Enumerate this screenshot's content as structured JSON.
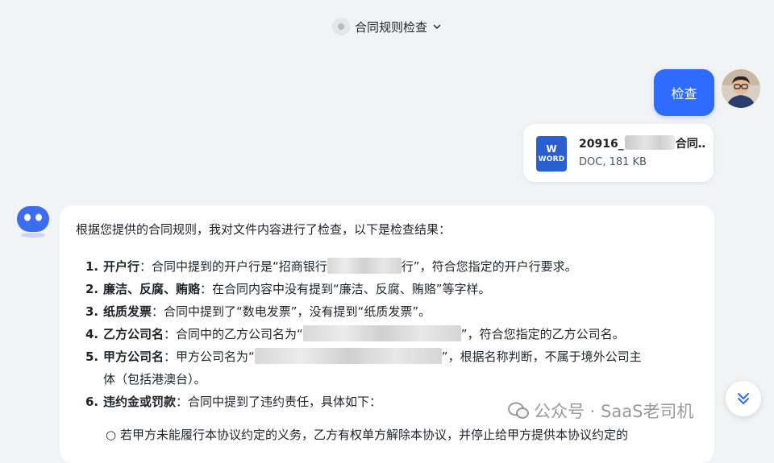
{
  "header": {
    "title": "合同规则检查"
  },
  "user": {
    "message": "检查",
    "file": {
      "name_prefix": "20916_",
      "name_suffix": "合同…",
      "meta": "DOC, 181 KB",
      "icon_letter": "W",
      "icon_label": "WORD"
    }
  },
  "bot": {
    "intro": "根据您提供的合同规则，我对文件内容进行了检查，以下是检查结果：",
    "items": [
      {
        "num": "1.",
        "title": "开户行",
        "text_a": "：合同中提到的开户行是“招商银行",
        "text_b": "行”，符合您指定的开户行要求。"
      },
      {
        "num": "2.",
        "title": "廉洁、反腐、贿赂",
        "text_a": "：在合同内容中没有提到“廉洁、反腐、贿赂”等字样。"
      },
      {
        "num": "3.",
        "title": "纸质发票",
        "text_a": "：合同中提到了“数电发票”，没有提到“纸质发票”。"
      },
      {
        "num": "4.",
        "title": "乙方公司名",
        "text_a": "：合同中的乙方公司名为“",
        "text_b": "”，符合您指定的乙方公司名。"
      },
      {
        "num": "5.",
        "title": "甲方公司名",
        "text_a": "：甲方公司名为“",
        "text_b": "”，根据名称判断，不属于境外公司主",
        "text_c": "体（包括港澳台）。"
      },
      {
        "num": "6.",
        "title": "违约金或罚款",
        "text_a": "：合同中提到了违约责任，具体如下："
      }
    ],
    "sub_item": "若甲方未能履行本协议约定的义务，乙方有权单方解除本协议，并停止给甲方提供本协议约定的"
  },
  "watermark": "公众号 · SaaS老司机",
  "colors": {
    "accent": "#2f6bff",
    "background": "#f2f3f5",
    "word_blue": "#2b5fd0"
  }
}
